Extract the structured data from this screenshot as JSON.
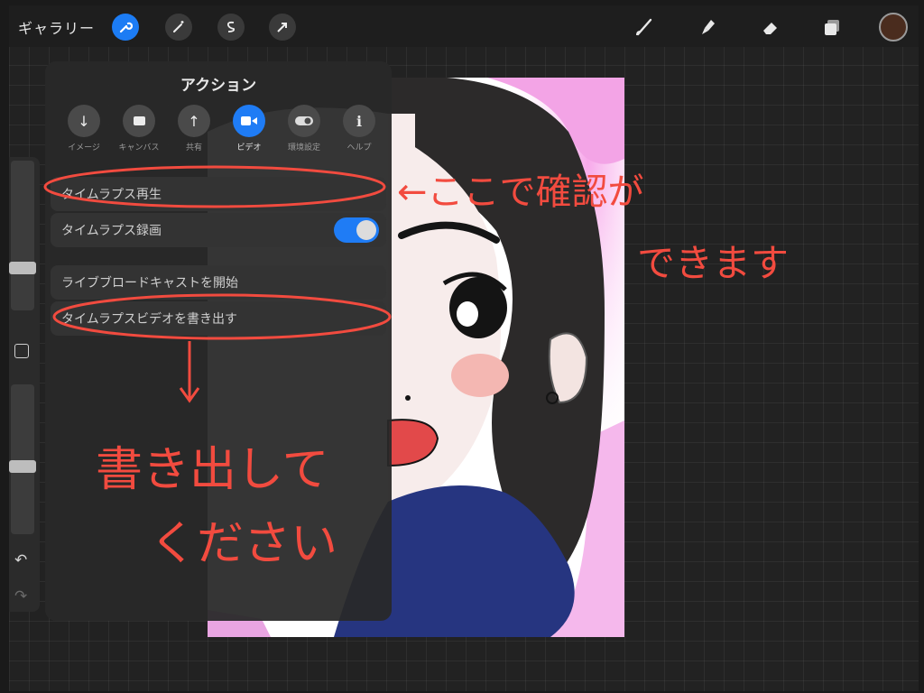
{
  "toolbar": {
    "gallery": "ギャラリー",
    "left_icons": [
      "wrench-icon",
      "magic-wand-icon",
      "selection-icon",
      "arrow-icon"
    ],
    "right_icons": [
      "brush-icon",
      "smudge-icon",
      "eraser-icon",
      "layers-icon"
    ],
    "current_color": "#4a2c1e"
  },
  "actions": {
    "title": "アクション",
    "tabs": [
      {
        "label": "イメージ",
        "icon": "download-icon"
      },
      {
        "label": "キャンバス",
        "icon": "canvas-icon"
      },
      {
        "label": "共有",
        "icon": "share-icon"
      },
      {
        "label": "ビデオ",
        "icon": "video-icon",
        "active": true
      },
      {
        "label": "環境設定",
        "icon": "toggle-icon"
      },
      {
        "label": "ヘルプ",
        "icon": "info-icon"
      }
    ],
    "items": {
      "timelapse_replay": "タイムラプス再生",
      "timelapse_record": "タイムラプス録画",
      "record_enabled": true,
      "live_broadcast": "ライブブロードキャストを開始",
      "export_timelapse": "タイムラプスビデオを書き出す"
    }
  },
  "annotations": {
    "note_right_1": "←ここで確認が",
    "note_right_2": "できます",
    "note_left_1": "書き出して",
    "note_left_2": "ください"
  },
  "colors": {
    "accent": "#1f7cf5",
    "annotation": "#f24b3f"
  }
}
